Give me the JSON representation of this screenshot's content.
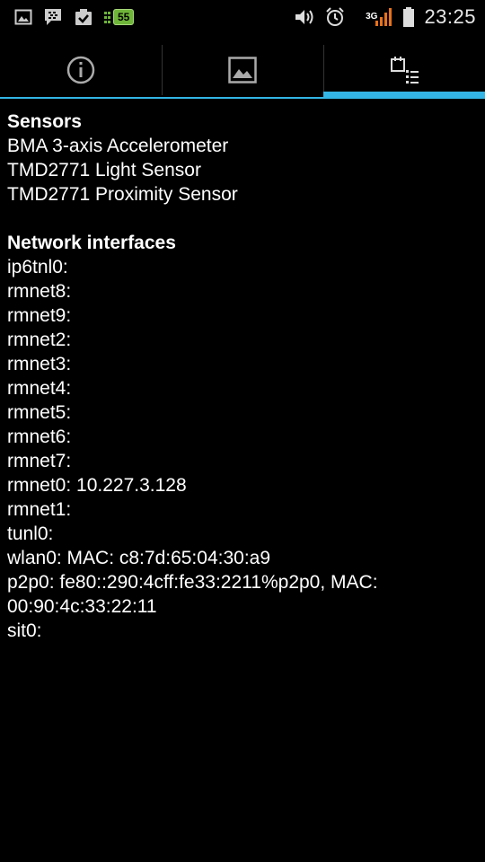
{
  "statusbar": {
    "left_icons": [
      "image-icon",
      "bbm-icon",
      "task-icon"
    ],
    "badge": "55",
    "right_icons": [
      "volume-icon",
      "alarm-icon"
    ],
    "network": "3G",
    "time": "23:25"
  },
  "tabs": [
    {
      "name": "info",
      "icon": "info-icon",
      "active": false
    },
    {
      "name": "image",
      "icon": "picture-icon",
      "active": false
    },
    {
      "name": "details",
      "icon": "calendar-list-icon",
      "active": true
    }
  ],
  "sensors": {
    "title": "Sensors",
    "items": [
      "BMA 3-axis Accelerometer",
      "TMD2771 Light Sensor",
      "TMD2771 Proximity Sensor"
    ]
  },
  "network": {
    "title": "Network interfaces",
    "items": [
      "ip6tnl0:",
      "rmnet8:",
      "rmnet9:",
      "rmnet2:",
      "rmnet3:",
      "rmnet4:",
      "rmnet5:",
      "rmnet6:",
      "rmnet7:",
      "rmnet0: 10.227.3.128",
      "rmnet1:",
      "tunl0:",
      "wlan0: MAC: c8:7d:65:04:30:a9",
      "p2p0: fe80::290:4cff:fe33:2211%p2p0, MAC: 00:90:4c:33:22:11",
      "sit0:"
    ]
  },
  "colors": {
    "accent": "#33b5e5",
    "badge": "#6fb53a",
    "signal": "#e8721c"
  }
}
